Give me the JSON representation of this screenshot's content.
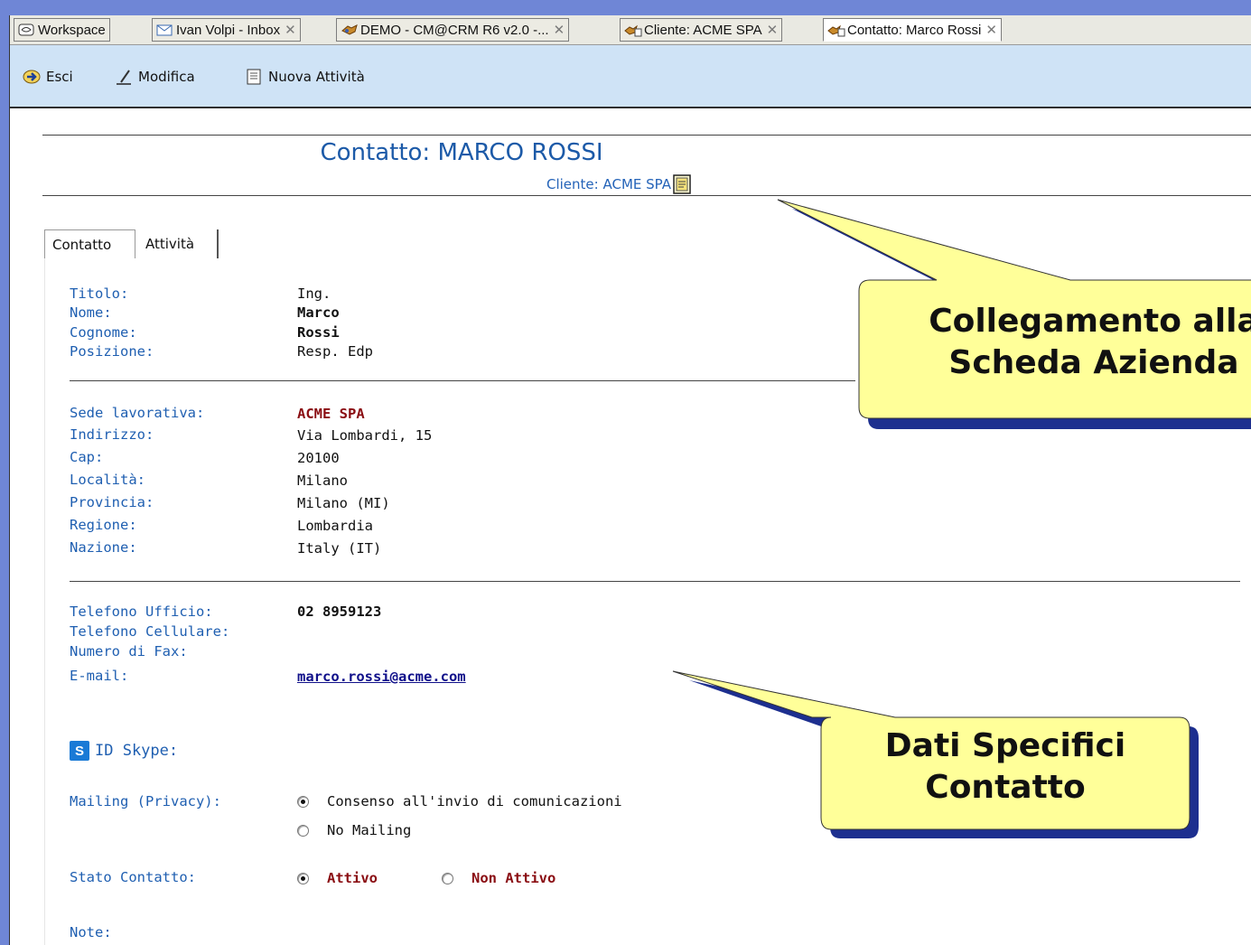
{
  "tabs": [
    {
      "label": "Workspace",
      "icon": "workspace-icon",
      "closable": false
    },
    {
      "label": "Ivan Volpi - Inbox",
      "icon": "inbox-icon",
      "closable": true
    },
    {
      "label": "DEMO - CM@CRM R6 v2.0 -...",
      "icon": "crm-icon",
      "closable": true
    },
    {
      "label": "Cliente: ACME SPA",
      "icon": "client-icon",
      "closable": true
    },
    {
      "label": "Contatto: Marco Rossi",
      "icon": "client-icon",
      "closable": true,
      "active": true
    }
  ],
  "toolbar": {
    "exit_label": "Esci",
    "edit_label": "Modifica",
    "new_activity_label": "Nuova Attività"
  },
  "header": {
    "title": "Contatto: MARCO ROSSI",
    "client_link": "Cliente: ACME SPA"
  },
  "inner_tabs": [
    "Contatto",
    "Attività"
  ],
  "personal": {
    "titolo_label": "Titolo:",
    "titolo": "Ing.",
    "nome_label": "Nome:",
    "nome": "Marco",
    "cognome_label": "Cognome:",
    "cognome": "Rossi",
    "posizione_label": "Posizione:",
    "posizione": "Resp. Edp"
  },
  "address": {
    "sede_label": "Sede lavorativa:",
    "sede": "ACME SPA",
    "indirizzo_label": "Indirizzo:",
    "indirizzo": "Via Lombardi, 15",
    "cap_label": "Cap:",
    "cap": "20100",
    "localita_label": "Località:",
    "localita": "Milano",
    "provincia_label": "Provincia:",
    "provincia": "Milano (MI)",
    "regione_label": "Regione:",
    "regione": "Lombardia",
    "nazione_label": "Nazione:",
    "nazione": "Italy (IT)"
  },
  "contacts": {
    "tel_ufficio_label": "Telefono Ufficio:",
    "tel_ufficio": "02 8959123",
    "tel_cell_label": "Telefono Cellulare:",
    "fax_label": "Numero di Fax:",
    "email_label": "E-mail:",
    "email": "marco.rossi@acme.com"
  },
  "skype_label": "ID Skype:",
  "mailing": {
    "label": "Mailing (Privacy):",
    "options": [
      "Consenso all'invio di comunicazioni",
      "No Mailing"
    ],
    "selected": 0
  },
  "stato": {
    "label": "Stato Contatto:",
    "options": [
      "Attivo",
      "Non Attivo"
    ],
    "selected": 0
  },
  "note_label": "Note:",
  "callouts": {
    "company": [
      "Collegamento alla",
      "Scheda Azienda"
    ],
    "contact": [
      "Dati Specifici",
      "Contatto"
    ]
  },
  "colors": {
    "label_blue": "#1f5fb1",
    "title_blue": "#1c5aa8",
    "accent_red": "#8a0d12",
    "callout_fill": "#ffff99",
    "callout_shadow": "#1d2f8f",
    "toolbar_bg": "#cfe3f6"
  }
}
